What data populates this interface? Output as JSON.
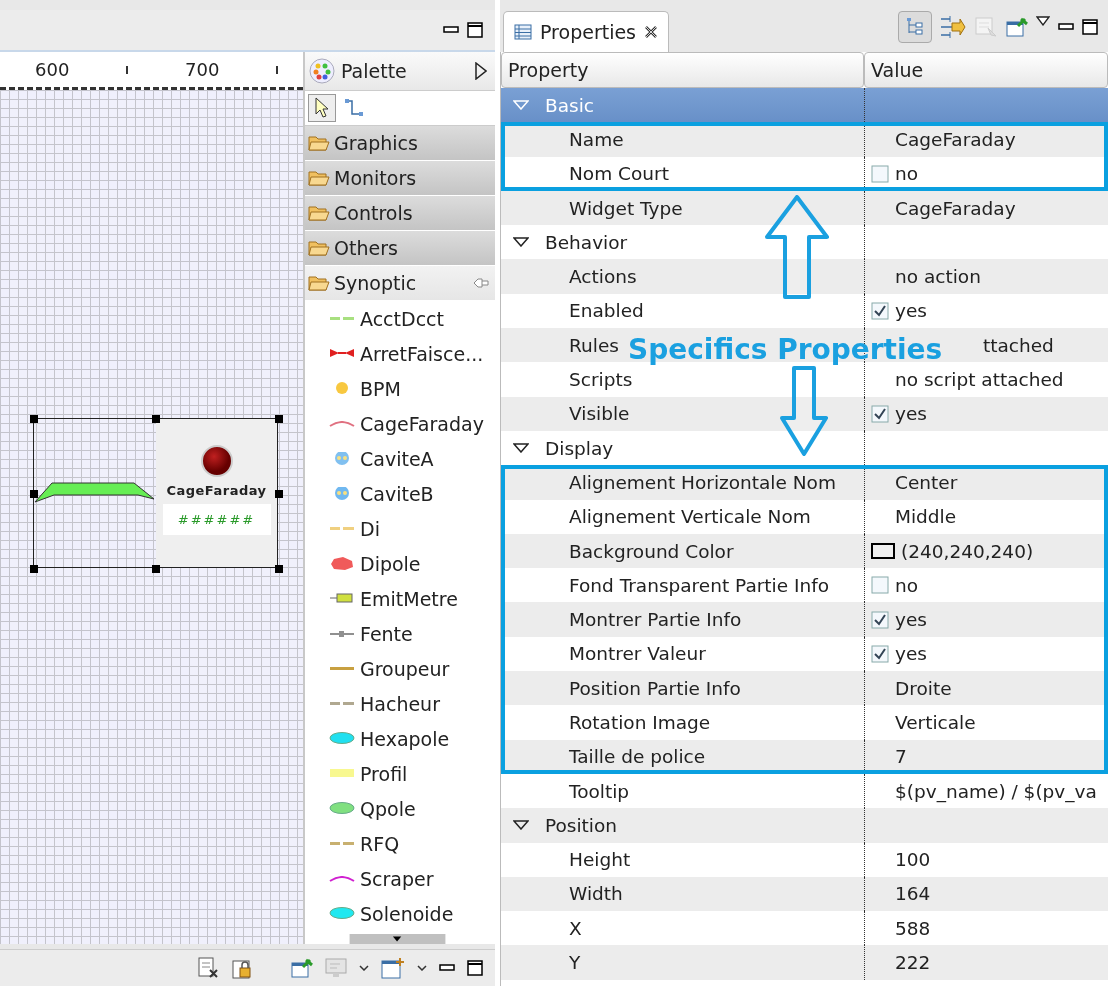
{
  "editor": {
    "ruler": [
      "600",
      "700"
    ],
    "widget": {
      "label": "CageFaraday",
      "value": "######"
    }
  },
  "palette": {
    "title": "Palette",
    "tools": [
      {
        "kind": "select",
        "selected": true
      },
      {
        "kind": "connection",
        "selected": false
      }
    ],
    "drawers": [
      {
        "label": "Graphics",
        "expanded": false
      },
      {
        "label": "Monitors",
        "expanded": false
      },
      {
        "label": "Controls",
        "expanded": false
      },
      {
        "label": "Others",
        "expanded": false
      },
      {
        "label": "Synoptic",
        "expanded": true,
        "items": [
          {
            "label": "AcctDcct",
            "kind": "dash",
            "color": "#a8e080"
          },
          {
            "label": "ArretFaisce...",
            "kind": "bowtie",
            "color": "#e02020"
          },
          {
            "label": "BPM",
            "kind": "dot",
            "color": "#f8c840"
          },
          {
            "label": "CageFaraday",
            "kind": "arc",
            "color": "#e07080"
          },
          {
            "label": "CaviteA",
            "kind": "cavity",
            "color": "#80c0f0"
          },
          {
            "label": "CaviteB",
            "kind": "cavity",
            "color": "#70b8f0"
          },
          {
            "label": "Di",
            "kind": "dash",
            "color": "#f0d080"
          },
          {
            "label": "Dipole",
            "kind": "blob",
            "color": "#f05a5a"
          },
          {
            "label": "EmitMetre",
            "kind": "meter",
            "color": "#d0e040"
          },
          {
            "label": "Fente",
            "kind": "slit",
            "color": "#909090"
          },
          {
            "label": "Groupeur",
            "kind": "bar",
            "color": "#c8a040"
          },
          {
            "label": "Hacheur",
            "kind": "dash",
            "color": "#b0a890"
          },
          {
            "label": "Hexapole",
            "kind": "oval",
            "color": "#20e0f0"
          },
          {
            "label": "Profil",
            "kind": "band",
            "color": "#f8f890"
          },
          {
            "label": "Qpole",
            "kind": "oval",
            "color": "#80e080"
          },
          {
            "label": "RFQ",
            "kind": "dash",
            "color": "#c8b070"
          },
          {
            "label": "Scraper",
            "kind": "arc",
            "color": "#d020d0"
          },
          {
            "label": "Solenoide",
            "kind": "oval",
            "color": "#20e8f0"
          }
        ]
      }
    ]
  },
  "properties": {
    "tab": "Properties",
    "columns": [
      "Property",
      "Value"
    ],
    "rows": [
      {
        "kind": "category",
        "label": "Basic",
        "expanded": true,
        "selected": true
      },
      {
        "kind": "highlight",
        "rows": [
          {
            "kind": "property",
            "label": "Name",
            "value": {
              "kind": "text",
              "text": "CageFaraday"
            }
          },
          {
            "kind": "property",
            "label": "Nom Court",
            "value": {
              "kind": "check",
              "checked": false,
              "text": "no"
            }
          }
        ]
      },
      {
        "kind": "property",
        "label": "Widget Type",
        "value": {
          "kind": "text",
          "text": "CageFaraday"
        }
      },
      {
        "kind": "category",
        "label": "Behavior",
        "expanded": true,
        "selected": false
      },
      {
        "kind": "property",
        "label": "Actions",
        "value": {
          "kind": "text",
          "text": "no action"
        }
      },
      {
        "kind": "property",
        "label": "Enabled",
        "value": {
          "kind": "check",
          "checked": true,
          "text": "yes"
        }
      },
      {
        "kind": "property",
        "label": "Rules",
        "value": {
          "kind": "text",
          "text": "ttached",
          "covered": true
        }
      },
      {
        "kind": "property",
        "label": "Scripts",
        "value": {
          "kind": "text",
          "text": "no script attached"
        }
      },
      {
        "kind": "property",
        "label": "Visible",
        "value": {
          "kind": "check",
          "checked": true,
          "text": "yes"
        }
      },
      {
        "kind": "category",
        "label": "Display",
        "expanded": true,
        "selected": false
      },
      {
        "kind": "highlight",
        "rows": [
          {
            "kind": "property",
            "label": "Alignement Horizontale Nom",
            "value": {
              "kind": "text",
              "text": "Center"
            }
          },
          {
            "kind": "property",
            "label": "Alignement Verticale Nom",
            "value": {
              "kind": "text",
              "text": "Middle"
            }
          },
          {
            "kind": "property",
            "label": "Background Color",
            "value": {
              "kind": "color",
              "color": "#f0f0f0",
              "text": "(240,240,240)"
            }
          },
          {
            "kind": "property",
            "label": "Fond Transparent Partie Info",
            "value": {
              "kind": "check",
              "checked": false,
              "text": "no"
            }
          },
          {
            "kind": "property",
            "label": "Montrer Partie Info",
            "value": {
              "kind": "check",
              "checked": true,
              "text": "yes"
            }
          },
          {
            "kind": "property",
            "label": "Montrer Valeur",
            "value": {
              "kind": "check",
              "checked": true,
              "text": "yes"
            }
          },
          {
            "kind": "property",
            "label": "Position Partie Info",
            "value": {
              "kind": "text",
              "text": "Droite"
            }
          },
          {
            "kind": "property",
            "label": "Rotation Image",
            "value": {
              "kind": "text",
              "text": "Verticale"
            }
          },
          {
            "kind": "property",
            "label": "Taille de police",
            "value": {
              "kind": "text",
              "text": "7"
            }
          }
        ]
      },
      {
        "kind": "property",
        "label": "Tooltip",
        "value": {
          "kind": "text",
          "text": "$(pv_name) / $(pv_va"
        }
      },
      {
        "kind": "category",
        "label": "Position",
        "expanded": true,
        "selected": false
      },
      {
        "kind": "property",
        "label": "Height",
        "value": {
          "kind": "text",
          "text": "100"
        }
      },
      {
        "kind": "property",
        "label": "Width",
        "value": {
          "kind": "text",
          "text": "164"
        }
      },
      {
        "kind": "property",
        "label": "X",
        "value": {
          "kind": "text",
          "text": "588"
        }
      },
      {
        "kind": "property",
        "label": "Y",
        "value": {
          "kind": "text",
          "text": "222"
        }
      }
    ]
  },
  "annotation": {
    "text": "Specifics Properties"
  }
}
